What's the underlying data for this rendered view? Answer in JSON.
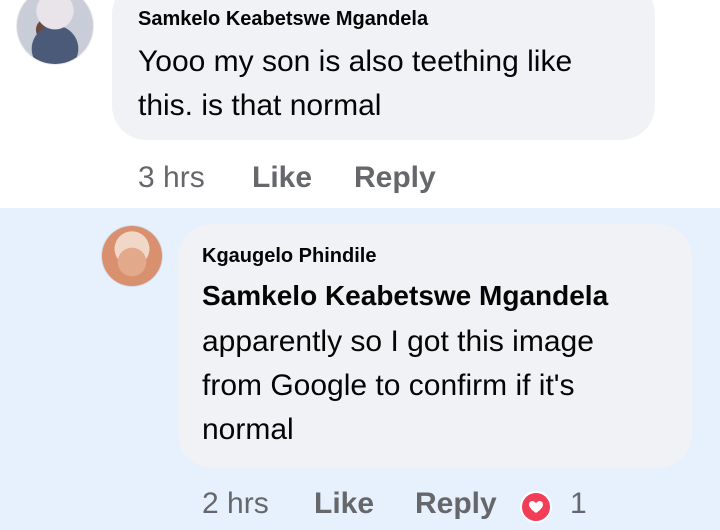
{
  "comment": {
    "author": "Samkelo Keabetswe Mgandela",
    "text": "Yooo my son is also teething like\nthis. is that normal",
    "time": "3 hrs",
    "like_label": "Like",
    "reply_label": "Reply"
  },
  "reply": {
    "author": "Kgaugelo Phindile",
    "tagged_name": "Samkelo Keabetswe Mgandela",
    "text": "apparently so I got this image\nfrom Google to confirm if it's\nnormal",
    "time": "2 hrs",
    "like_label": "Like",
    "reply_label": "Reply",
    "reaction_count": "1",
    "reaction_type": "love-icon",
    "reaction_color": "#f33e58"
  },
  "colors": {
    "bubble": "#f0f2f5",
    "reply_highlight": "#e7f0fd",
    "meta_text": "#65676b"
  }
}
